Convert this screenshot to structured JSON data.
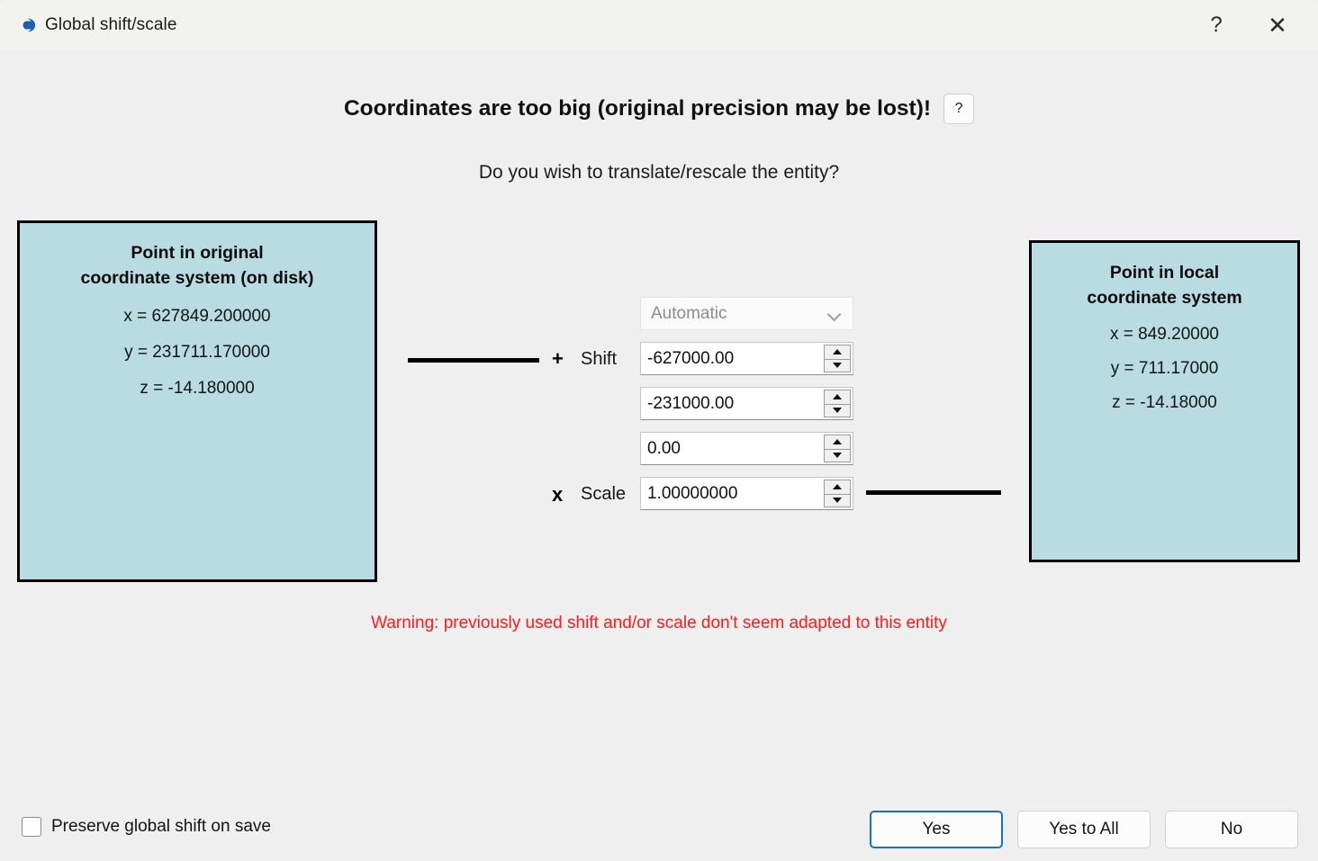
{
  "window": {
    "title": "Global shift/scale",
    "logo_icon": "cloudcompare-cc-icon",
    "help_icon": "?",
    "close_icon": "✕"
  },
  "dialog": {
    "headline": "Coordinates are too big (original precision may be lost)!",
    "headline_help_label": "?",
    "subheadline": "Do you wish to translate/rescale the entity?",
    "warning": "Warning: previously used shift and/or scale don't seem adapted to this entity",
    "warning_color": "#ff1a1a",
    "panel_color": "#b8dce1"
  },
  "original_panel": {
    "title_line1": "Point in original",
    "title_line2": "coordinate system (on disk)",
    "x": "x = 627849.200000",
    "y": "y = 231711.170000",
    "z": "z = -14.180000"
  },
  "local_panel": {
    "title_line1": "Point in local",
    "title_line2": "coordinate system",
    "x": "x = 849.20000",
    "y": "y = 711.17000",
    "z": "z = -14.18000"
  },
  "controls": {
    "preset_selected": "Automatic",
    "preset_options": [
      "Automatic"
    ],
    "plus_symbol": "+",
    "times_symbol": "x",
    "shift_label": "Shift",
    "scale_label": "Scale",
    "shift_x": "-627000.00",
    "shift_y": "-231000.00",
    "shift_z": "0.00",
    "scale": "1.00000000"
  },
  "footer": {
    "preserve_label": "Preserve global shift on save",
    "preserve_checked": false,
    "yes_label": "Yes",
    "yes_to_all_label": "Yes to All",
    "no_label": "No",
    "default_button_color": "#1572c4"
  }
}
